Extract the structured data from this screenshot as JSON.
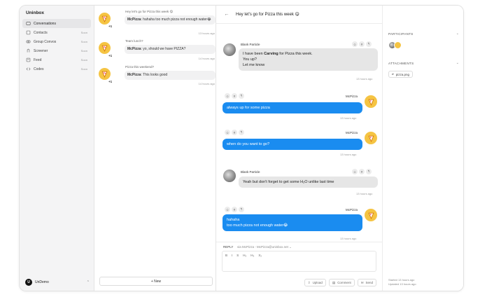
{
  "app": {
    "name": "Uninbox"
  },
  "sidebar": {
    "items": [
      {
        "label": "Conversations",
        "badge": "",
        "icon": "chat-icon"
      },
      {
        "label": "Contacts",
        "badge": "Soon",
        "icon": "contacts-icon"
      },
      {
        "label": "Group Convos",
        "badge": "Soon",
        "icon": "group-icon"
      },
      {
        "label": "Screener",
        "badge": "Soon",
        "icon": "screener-icon"
      },
      {
        "label": "Feed",
        "badge": "Soon",
        "icon": "feed-icon"
      },
      {
        "label": "Codes",
        "badge": "Soon",
        "icon": "code-icon"
      }
    ],
    "user": {
      "initials": "U",
      "name": "UnDemo"
    }
  },
  "conversations": [
    {
      "subject": "Hey let's go for Pizza this week 😋",
      "sender": "McPizza",
      "preview": ": hahaha too much pizza not enough water😂",
      "time": "13 hours ago",
      "extra": "+1"
    },
    {
      "subject": "Team lunch?",
      "sender": "McPizza",
      "preview": ": yo, should we have PIZZA?",
      "time": "14 hours ago",
      "extra": "+1"
    },
    {
      "subject": "Pizza this weekend?",
      "sender": "McPizza",
      "preview": ": This looks good",
      "time": "14 hours ago",
      "extra": "+1"
    }
  ],
  "new_button": "+ New",
  "chat": {
    "title": "Hey let's go for Pizza this week 😋",
    "messages": [
      {
        "sender": "Blank Particle",
        "pre": "I have been ",
        "bold": "Carving",
        "post": " for Pizza this week.",
        "line2": "You up?",
        "line3": "Let me know",
        "time": "13 hours ago"
      },
      {
        "sender": "McPizza",
        "text": "always up for some pizza",
        "time": "13 hours ago"
      },
      {
        "sender": "McPizza",
        "text": "when do you want to go?",
        "time": "13 hours ago"
      },
      {
        "sender": "Blank Particle",
        "text": "Yeah but don't forget to get some H₂O unlike last time",
        "time": "13 hours ago"
      },
      {
        "sender": "McPizza",
        "text": "hahaha",
        "line2": "too much pizza not enough water😂",
        "time": "13 hours ago"
      }
    ],
    "reply": {
      "label": "REPLY",
      "via": "via McPizza - McPizza@uninbox.net ⌄",
      "tools": [
        "B",
        "I",
        "S",
        "H₂",
        "H₃",
        "X₂"
      ],
      "buttons": [
        "Upload",
        "Comment",
        "Send"
      ]
    }
  },
  "panel": {
    "participants_label": "PARTICIPANTS",
    "attachments_label": "ATTACHMENTS",
    "attachment": "pizza.png",
    "started": "Started 13 hours ago",
    "updated": "Updated 13 hours ago"
  },
  "colors": {
    "accent": "#1a8cf0",
    "pizza": "#f5c443"
  }
}
